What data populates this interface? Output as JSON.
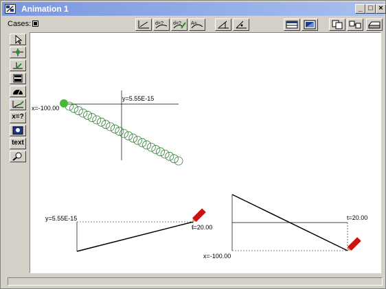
{
  "window": {
    "title": "Animation 1",
    "minimize_glyph": "_",
    "maximize_glyph": "□",
    "close_glyph": "×"
  },
  "toolbar": {
    "cases_label": "Cases:",
    "buttons": [
      "graph-xy-icon",
      "calculate-icon",
      "calculate-edit-icon",
      "fit-icon",
      "slope-icon",
      "angle-icon",
      "table-icon",
      "image-icon",
      "copy-icon",
      "paste-icon",
      "print-icon"
    ]
  },
  "palette": {
    "items": [
      {
        "icon": "arrow-select-icon",
        "text": ""
      },
      {
        "icon": "particle-icon",
        "text": ""
      },
      {
        "icon": "vector-icon",
        "text": ""
      },
      {
        "icon": "meter-icon",
        "text": ""
      },
      {
        "icon": "gauge-icon",
        "text": ""
      },
      {
        "icon": "graph-pen-icon",
        "text": ""
      },
      {
        "icon": "",
        "text": "x=?"
      },
      {
        "icon": "picture-icon",
        "text": ""
      },
      {
        "icon": "",
        "text": "text"
      },
      {
        "icon": "zoom-icon",
        "text": ""
      }
    ]
  },
  "canvas": {
    "particle_label_x": "x=-100.00",
    "particle_label_y": "y=5.55E-15",
    "graph1_label_y": "y=5.55E-15",
    "graph1_label_t": "t=20.00",
    "graph2_label_t": "t=20.00",
    "graph2_label_x": "x=-100.00",
    "colors": {
      "particle": "#44bb33",
      "trail": "#2e7d32",
      "pencil_red": "#cc1111"
    }
  }
}
